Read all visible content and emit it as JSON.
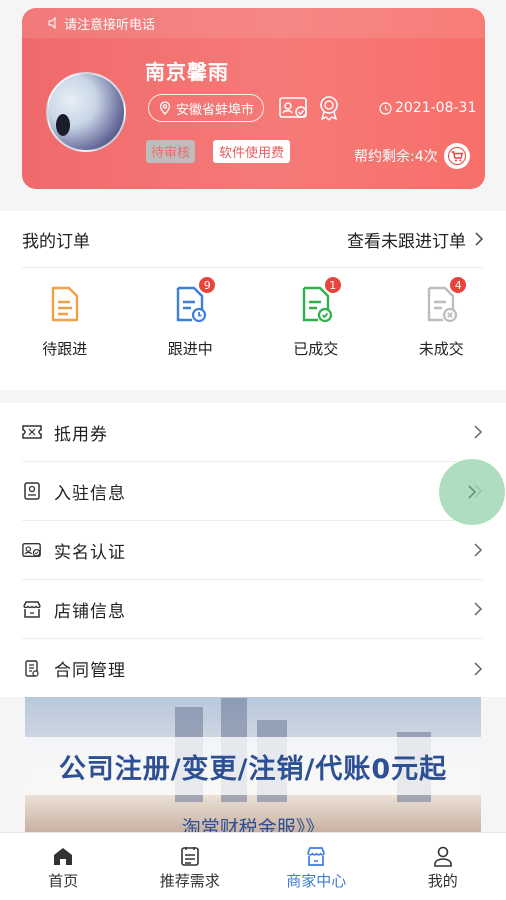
{
  "profile": {
    "notice": "请注意接听电话",
    "name": "南京馨雨",
    "location": "安徽省蚌埠市",
    "date": "2021-08-31",
    "status_badge": "待审核",
    "fee_badge": "软件使用费",
    "remaining": "帮约剩余:4次"
  },
  "orders": {
    "title": "我的订单",
    "view_link": "查看未跟进订单",
    "statuses": [
      {
        "label": "待跟进",
        "count": null,
        "color": "#f0a047"
      },
      {
        "label": "跟进中",
        "count": "9",
        "color": "#3d7fd9"
      },
      {
        "label": "已成交",
        "count": "1",
        "color": "#2fb04a"
      },
      {
        "label": "未成交",
        "count": "4",
        "color": "#bdbdbd"
      }
    ]
  },
  "menu": {
    "items": [
      {
        "label": "抵用券",
        "icon": "ticket-icon"
      },
      {
        "label": "入驻信息",
        "icon": "info-card-icon"
      },
      {
        "label": "实名认证",
        "icon": "id-card-icon"
      },
      {
        "label": "店铺信息",
        "icon": "shop-icon"
      },
      {
        "label": "合同管理",
        "icon": "contract-icon"
      }
    ]
  },
  "banner": {
    "title": "公司注册/变更/注销/代账0元起",
    "subtitle": "淘常财税金服》》"
  },
  "tabbar": {
    "items": [
      {
        "label": "首页",
        "icon": "home-icon"
      },
      {
        "label": "推荐需求",
        "icon": "list-icon"
      },
      {
        "label": "商家中心",
        "icon": "store-icon",
        "active": true
      },
      {
        "label": "我的",
        "icon": "user-icon"
      }
    ]
  },
  "colors": {
    "card_gradient": [
      "#f06a6b",
      "#f86f6a"
    ],
    "accent_blue": "#3d7fd9",
    "badge_red": "#e8443c",
    "float_green": "#a0d8b4"
  }
}
